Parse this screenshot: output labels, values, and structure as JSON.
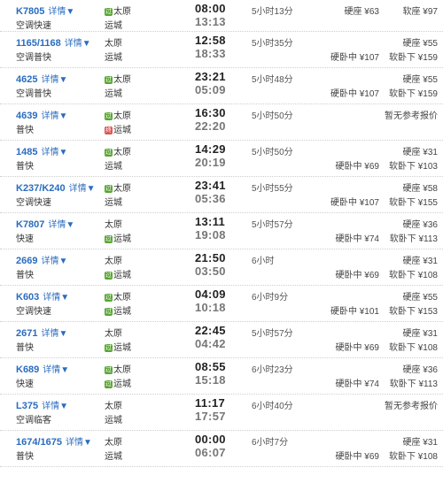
{
  "detail_label": "详情▼",
  "rows": [
    {
      "train": "K7805",
      "type": "空调快速",
      "from": "太原",
      "from_badge": "过",
      "to": "运城",
      "to_badge": "",
      "dep": "08:00",
      "arr": "13:13",
      "dur": "5小时13分",
      "p1": "硬座 ¥63",
      "p2": "",
      "p3": "软座 ¥97",
      "p4": ""
    },
    {
      "train": "1165/1168",
      "type": "空调普快",
      "from": "太原",
      "from_badge": "",
      "to": "运城",
      "to_badge": "",
      "dep": "12:58",
      "arr": "18:33",
      "dur": "5小时35分",
      "p1": "",
      "p2": "硬卧中 ¥107",
      "p3": "硬座 ¥55",
      "p4": "软卧下 ¥159"
    },
    {
      "train": "4625",
      "type": "空调普快",
      "from": "太原",
      "from_badge": "过",
      "to": "运城",
      "to_badge": "",
      "dep": "23:21",
      "arr": "05:09",
      "dur": "5小时48分",
      "p1": "",
      "p2": "硬卧中 ¥107",
      "p3": "硬座 ¥55",
      "p4": "软卧下 ¥159"
    },
    {
      "train": "4639",
      "type": "普快",
      "from": "太原",
      "from_badge": "过",
      "to": "运城",
      "to_badge": "终",
      "dep": "16:30",
      "arr": "22:20",
      "dur": "5小时50分",
      "p1": "",
      "p2": "",
      "p3": "暂无参考报价",
      "p4": ""
    },
    {
      "train": "1485",
      "type": "普快",
      "from": "太原",
      "from_badge": "过",
      "to": "运城",
      "to_badge": "",
      "dep": "14:29",
      "arr": "20:19",
      "dur": "5小时50分",
      "p1": "",
      "p2": "硬卧中 ¥69",
      "p3": "硬座 ¥31",
      "p4": "软卧下 ¥103"
    },
    {
      "train": "K237/K240",
      "type": "空调快速",
      "from": "太原",
      "from_badge": "过",
      "to": "运城",
      "to_badge": "",
      "dep": "23:41",
      "arr": "05:36",
      "dur": "5小时55分",
      "p1": "",
      "p2": "硬卧中 ¥107",
      "p3": "硬座 ¥58",
      "p4": "软卧下 ¥155"
    },
    {
      "train": "K7807",
      "type": "快速",
      "from": "太原",
      "from_badge": "",
      "to": "运城",
      "to_badge": "过",
      "dep": "13:11",
      "arr": "19:08",
      "dur": "5小时57分",
      "p1": "",
      "p2": "硬卧中 ¥74",
      "p3": "硬座 ¥36",
      "p4": "软卧下 ¥113"
    },
    {
      "train": "2669",
      "type": "普快",
      "from": "太原",
      "from_badge": "",
      "to": "运城",
      "to_badge": "过",
      "dep": "21:50",
      "arr": "03:50",
      "dur": "6小时",
      "p1": "",
      "p2": "硬卧中 ¥69",
      "p3": "硬座 ¥31",
      "p4": "软卧下 ¥108"
    },
    {
      "train": "K603",
      "type": "空调快速",
      "from": "太原",
      "from_badge": "过",
      "to": "运城",
      "to_badge": "过",
      "dep": "04:09",
      "arr": "10:18",
      "dur": "6小时9分",
      "p1": "",
      "p2": "硬卧中 ¥101",
      "p3": "硬座 ¥55",
      "p4": "软卧下 ¥153"
    },
    {
      "train": "2671",
      "type": "普快",
      "from": "太原",
      "from_badge": "",
      "to": "运城",
      "to_badge": "过",
      "dep": "22:45",
      "arr": "04:42",
      "dur": "5小时57分",
      "p1": "",
      "p2": "硬卧中 ¥69",
      "p3": "硬座 ¥31",
      "p4": "软卧下 ¥108"
    },
    {
      "train": "K689",
      "type": "快速",
      "from": "太原",
      "from_badge": "过",
      "to": "运城",
      "to_badge": "过",
      "dep": "08:55",
      "arr": "15:18",
      "dur": "6小时23分",
      "p1": "",
      "p2": "硬卧中 ¥74",
      "p3": "硬座 ¥36",
      "p4": "软卧下 ¥113"
    },
    {
      "train": "L375",
      "type": "空调临客",
      "from": "太原",
      "from_badge": "",
      "to": "运城",
      "to_badge": "",
      "dep": "11:17",
      "arr": "17:57",
      "dur": "6小时40分",
      "p1": "",
      "p2": "",
      "p3": "暂无参考报价",
      "p4": ""
    },
    {
      "train": "1674/1675",
      "type": "普快",
      "from": "太原",
      "from_badge": "",
      "to": "运城",
      "to_badge": "",
      "dep": "00:00",
      "arr": "06:07",
      "dur": "6小时7分",
      "p1": "",
      "p2": "硬卧中 ¥69",
      "p3": "硬座 ¥31",
      "p4": "软卧下 ¥108"
    }
  ],
  "colors": {
    "train_link": "#2a6cbf",
    "pass_badge": "#5aa634",
    "end_badge": "#d9534f"
  }
}
